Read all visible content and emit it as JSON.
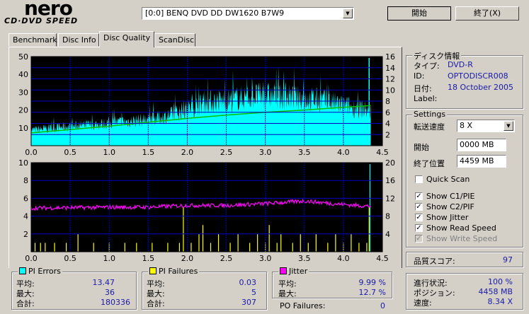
{
  "logo": {
    "line1": "nero",
    "line2": "CD·DVD SPEED"
  },
  "drive": {
    "label": "[0:0]   BENQ DVD DD DW1620 B7W9"
  },
  "buttons": {
    "start": "開始",
    "exit": "終了(X)"
  },
  "tabs": [
    {
      "label": "Benchmark"
    },
    {
      "label": "Disc Info"
    },
    {
      "label": "Disc Quality"
    },
    {
      "label": "ScanDisc"
    }
  ],
  "disc_info": {
    "title": "ディスク情報",
    "type_label": "タイプ:",
    "type_value": "DVD-R",
    "id_label": "ID:",
    "id_value": "OPTODISCR008",
    "date_label": "日付:",
    "date_value": "18 October 2005",
    "label_label": "Label:"
  },
  "settings": {
    "title": "Settings",
    "speed_label": "転送速度",
    "speed_value": "8 X",
    "start_label": "開始",
    "start_value": "0000 MB",
    "end_label": "終了位置",
    "end_value": "4459 MB",
    "quick_scan": "Quick Scan",
    "show_c1": "Show C1/PIE",
    "show_c2": "Show C2/PIF",
    "show_jitter": "Show Jitter",
    "show_read": "Show Read Speed",
    "show_write": "Show Write Speed"
  },
  "quality": {
    "label": "品質スコア:",
    "value": "97"
  },
  "progress": {
    "progress_label": "進行状況:",
    "progress_value": "100 %",
    "position_label": "ポジション:",
    "position_value": "4458 MB",
    "speed_label": "速度:",
    "speed_value": "8.34 X"
  },
  "pi_errors": {
    "title": "PI Errors",
    "avg_label": "平均:",
    "avg": "13.47",
    "max_label": "最大:",
    "max": "36",
    "total_label": "合計:",
    "total": "180336"
  },
  "pi_failures": {
    "title": "PI Failures",
    "avg_label": "平均:",
    "avg": "0.03",
    "max_label": "最大:",
    "max": "5",
    "total_label": "合計:",
    "total": "307"
  },
  "jitter": {
    "title": "Jitter",
    "avg_label": "平均:",
    "avg": "9.99 %",
    "max_label": "最大:",
    "max": "12.7 %"
  },
  "po_failures": {
    "label": "PO Failures:",
    "value": "0"
  },
  "colors": {
    "pie": "#00ffff",
    "pif": "#ffff00",
    "jitter": "#ff00ff",
    "speed": "#00c000",
    "grid": "#0000c8",
    "plot_bg": "#000000"
  },
  "chart_data": [
    {
      "type": "area",
      "x_ticks": [
        "0.0",
        "0.5",
        "1.0",
        "1.5",
        "2.0",
        "2.5",
        "3.0",
        "3.5",
        "4.0",
        "4.5"
      ],
      "y_left_ticks": [
        "10",
        "20",
        "30",
        "40",
        "50"
      ],
      "y_right_ticks": [
        "2",
        "4",
        "6",
        "8",
        "10",
        "12",
        "14",
        "16"
      ],
      "xlim": [
        0,
        4.5
      ],
      "ylim": [
        0,
        50
      ],
      "y2lim": [
        0,
        16
      ],
      "series": [
        {
          "values": [
            [
              0,
              9
            ],
            [
              0.25,
              10
            ],
            [
              0.5,
              11
            ],
            [
              0.75,
              12
            ],
            [
              1.0,
              13
            ],
            [
              1.25,
              14
            ],
            [
              1.5,
              15
            ],
            [
              1.75,
              17
            ],
            [
              2.0,
              21
            ],
            [
              2.25,
              25
            ],
            [
              2.5,
              26
            ],
            [
              2.75,
              28
            ],
            [
              3.0,
              29
            ],
            [
              3.25,
              28
            ],
            [
              3.5,
              27
            ],
            [
              3.75,
              26
            ],
            [
              4.0,
              23
            ],
            [
              4.25,
              21
            ],
            [
              4.35,
              20
            ]
          ]
        },
        {
          "values": [
            [
              0,
              2.3
            ],
            [
              0.5,
              2.9
            ],
            [
              1.0,
              3.5
            ],
            [
              1.5,
              4.2
            ],
            [
              2.0,
              4.9
            ],
            [
              2.5,
              5.5
            ],
            [
              3.0,
              6.0
            ],
            [
              3.5,
              6.4
            ],
            [
              4.0,
              6.9
            ],
            [
              4.35,
              7.2
            ]
          ]
        }
      ]
    },
    {
      "type": "bar",
      "x_ticks": [
        "0.0",
        "0.5",
        "1.0",
        "1.5",
        "2.0",
        "2.5",
        "3.0",
        "3.5",
        "4.0",
        "4.5"
      ],
      "y_left_ticks": [
        "2",
        "4",
        "6",
        "8",
        "10"
      ],
      "y_right_ticks": [
        "4",
        "8",
        "12",
        "16",
        "20"
      ],
      "xlim": [
        0,
        4.5
      ],
      "ylim": [
        0,
        10
      ],
      "y2lim": [
        0,
        20
      ],
      "series": [
        {
          "values": [
            [
              0.05,
              1
            ],
            [
              0.12,
              1
            ],
            [
              0.18,
              1
            ],
            [
              0.3,
              1
            ],
            [
              0.45,
              1
            ],
            [
              0.6,
              2
            ],
            [
              0.8,
              1
            ],
            [
              1.0,
              1
            ],
            [
              1.2,
              1
            ],
            [
              1.35,
              1
            ],
            [
              1.55,
              1
            ],
            [
              1.75,
              1
            ],
            [
              1.9,
              1
            ],
            [
              1.95,
              5
            ],
            [
              2.05,
              1
            ],
            [
              2.15,
              2
            ],
            [
              2.2,
              3
            ],
            [
              2.3,
              1
            ],
            [
              2.4,
              2
            ],
            [
              2.55,
              1
            ],
            [
              2.65,
              2
            ],
            [
              2.8,
              1
            ],
            [
              2.9,
              2
            ],
            [
              3.0,
              1
            ],
            [
              3.05,
              3
            ],
            [
              3.15,
              1
            ],
            [
              3.2,
              2
            ],
            [
              3.35,
              1
            ],
            [
              3.45,
              2
            ],
            [
              3.55,
              1
            ],
            [
              3.65,
              2
            ],
            [
              3.8,
              1
            ],
            [
              3.9,
              2
            ],
            [
              4.0,
              1
            ],
            [
              4.1,
              2
            ],
            [
              4.2,
              1
            ],
            [
              4.3,
              1
            ],
            [
              4.33,
              5
            ]
          ]
        },
        {
          "values": [
            [
              0,
              9.8
            ],
            [
              0.5,
              9.9
            ],
            [
              1.0,
              10.0
            ],
            [
              1.5,
              10.0
            ],
            [
              2.0,
              10.4
            ],
            [
              2.5,
              10.4
            ],
            [
              3.0,
              10.8
            ],
            [
              3.5,
              11.4
            ],
            [
              4.0,
              10.6
            ],
            [
              4.35,
              10.2
            ]
          ]
        }
      ]
    }
  ]
}
